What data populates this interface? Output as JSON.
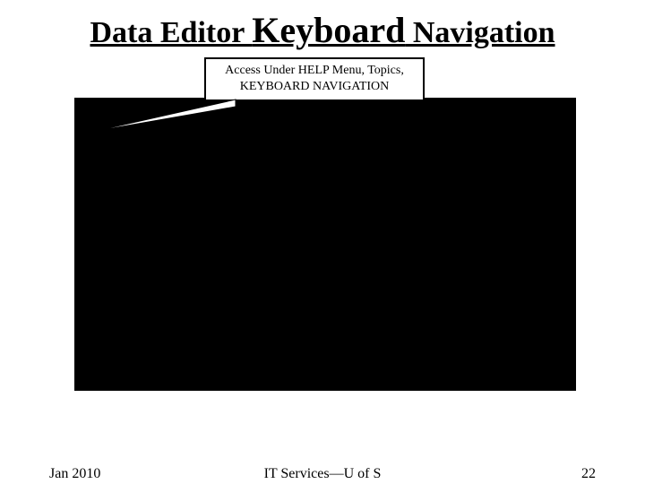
{
  "title": {
    "part1": "Data Editor ",
    "keyword": "Keyboard",
    "part2": " Navigation"
  },
  "callout": {
    "line1": "Access Under HELP Menu, Topics,",
    "line2": "KEYBOARD NAVIGATION"
  },
  "footer": {
    "date": "Jan 2010",
    "center": "IT Services—U of  S",
    "page": "22"
  }
}
